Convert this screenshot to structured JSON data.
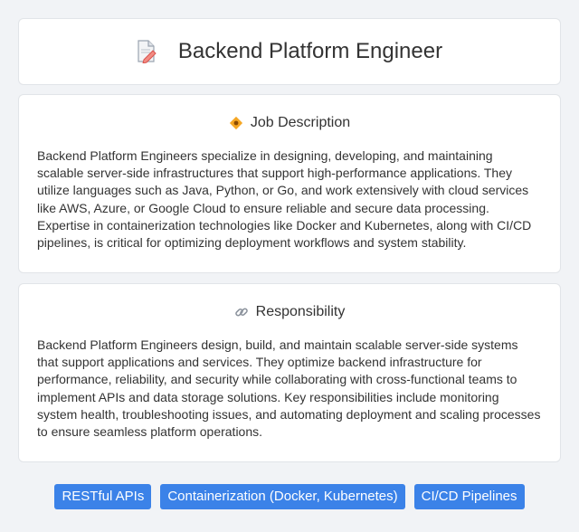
{
  "header": {
    "title": "Backend Platform Engineer",
    "icon": "document-pencil-icon"
  },
  "sections": [
    {
      "heading": "Job Description",
      "icon": "diamond-badge-icon",
      "body": "Backend Platform Engineers specialize in designing, developing, and maintaining scalable server-side infrastructures that support high-performance applications. They utilize languages such as Java, Python, or Go, and work extensively with cloud services like AWS, Azure, or Google Cloud to ensure reliable and secure data processing. Expertise in containerization technologies like Docker and Kubernetes, along with CI/CD pipelines, is critical for optimizing deployment workflows and system stability."
    },
    {
      "heading": "Responsibility",
      "icon": "link-icon",
      "body": "Backend Platform Engineers design, build, and maintain scalable server-side systems that support applications and services. They optimize backend infrastructure for performance, reliability, and security while collaborating with cross-functional teams to implement APIs and data storage solutions. Key responsibilities include monitoring system health, troubleshooting issues, and automating deployment and scaling processes to ensure seamless platform operations."
    }
  ],
  "tags": [
    "RESTful APIs",
    "Containerization (Docker, Kubernetes)",
    "CI/CD Pipelines"
  ],
  "colors": {
    "background": "#f1f3f6",
    "card": "#ffffff",
    "tag": "#3b82e8"
  }
}
